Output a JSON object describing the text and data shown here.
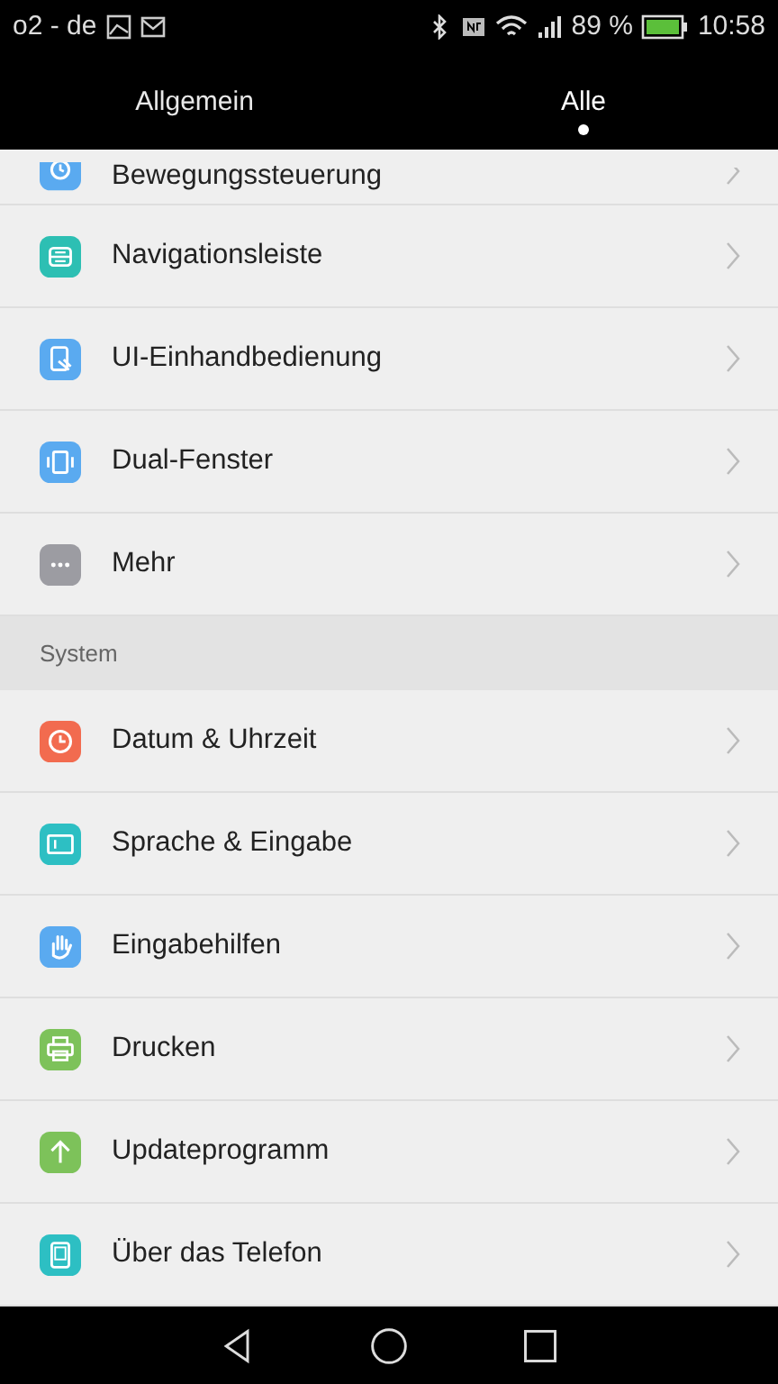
{
  "status_bar": {
    "carrier": "o2 - de",
    "battery": "89 %",
    "time": "10:58"
  },
  "tabs": [
    {
      "label": "Allgemein",
      "selected": false
    },
    {
      "label": "Alle",
      "selected": true
    }
  ],
  "sections": [
    {
      "items": [
        {
          "label": "Bewegungssteuerung",
          "color": "#5aaaf0",
          "partial": true
        },
        {
          "label": "Navigationsleiste",
          "color": "#2dbfb3"
        },
        {
          "label": "UI-Einhandbedienung",
          "color": "#5aaaf0"
        },
        {
          "label": "Dual-Fenster",
          "color": "#5aaaf0"
        },
        {
          "label": "Mehr",
          "color": "#9c9ca2"
        }
      ]
    },
    {
      "title": "System",
      "items": [
        {
          "label": "Datum & Uhrzeit",
          "color": "#f26b4f"
        },
        {
          "label": "Sprache & Eingabe",
          "color": "#2dbfc3"
        },
        {
          "label": "Eingabehilfen",
          "color": "#5aaaf0"
        },
        {
          "label": "Drucken",
          "color": "#7dc25a"
        },
        {
          "label": "Updateprogramm",
          "color": "#7dc25a"
        },
        {
          "label": "Über das Telefon",
          "color": "#2dbfc3"
        }
      ]
    }
  ]
}
